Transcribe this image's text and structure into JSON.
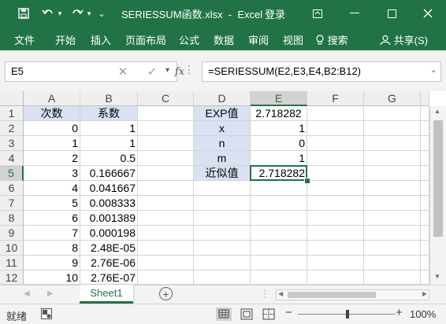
{
  "titlebar": {
    "save_icon": "save-icon",
    "undo_icon": "undo-icon",
    "redo_icon": "redo-icon",
    "title": "SERIESSUM函数.xlsx  -  Excel",
    "login": "登录",
    "ribbon_display_icon": "ribbon-display-icon",
    "minimize_icon": "minimize-icon",
    "maximize_icon": "maximize-icon",
    "close_icon": "close-icon"
  },
  "ribbon": {
    "tabs": [
      "文件",
      "开始",
      "插入",
      "页面布局",
      "公式",
      "数据",
      "审阅",
      "视图"
    ],
    "search": "搜索",
    "share": "共享(S)"
  },
  "formula_bar": {
    "name_box": "E5",
    "fx": "fx",
    "formula": "=SERIESSUM(E2,E3,E4,B2:B12)"
  },
  "columns": [
    "A",
    "B",
    "C",
    "D",
    "E",
    "F",
    "G"
  ],
  "rows": [
    "1",
    "2",
    "3",
    "4",
    "5",
    "6",
    "7",
    "8",
    "9",
    "10",
    "11",
    "12"
  ],
  "cells": {
    "A": [
      "次数",
      "0",
      "1",
      "2",
      "3",
      "4",
      "5",
      "6",
      "7",
      "8",
      "9",
      "10"
    ],
    "B": [
      "系数",
      "1",
      "1",
      "0.5",
      "0.166667",
      "0.041667",
      "0.008333",
      "0.001389",
      "0.000198",
      "2.48E-05",
      "2.76E-06",
      "2.76E-07"
    ],
    "D": [
      "EXP值",
      "x",
      "n",
      "m",
      "近似值"
    ],
    "E": [
      "2.718282",
      "1",
      "0",
      "1",
      "2.718282"
    ]
  },
  "selected_cell": "E5",
  "sheet_tab": "Sheet1",
  "status": {
    "ready": "就绪",
    "zoom": "100%"
  },
  "colors": {
    "accent": "#217346",
    "header_fill": "#d9e1f2"
  }
}
